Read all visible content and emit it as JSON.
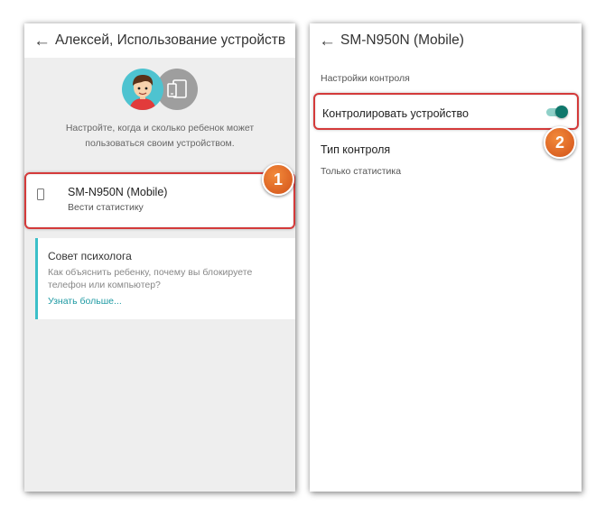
{
  "left_screen": {
    "back_icon": "←",
    "title": "Алексей, Использование устройств",
    "illustration": {
      "avatar_icon": "child-avatar-icon",
      "devices_icon": "devices-icon",
      "colors": {
        "avatar_bg": "#4ec3d0",
        "devices_bg": "#9e9e9e"
      }
    },
    "intro_text": "Настройте, когда и сколько ребенок может пользоваться своим устройством.",
    "device": {
      "icon": "phone-icon",
      "name": "SM-N950N (Mobile)",
      "subtitle": "Вести статистику"
    },
    "tip": {
      "title": "Совет психолога",
      "body": "Как объяснить ребенку, почему вы блокируете телефон или компьютер?",
      "link": "Узнать больше..."
    },
    "callout_number": "1"
  },
  "right_screen": {
    "back_icon": "←",
    "title": "SM-N950N (Mobile)",
    "section_label": "Настройки контроля",
    "control_label": "Контролировать устройство",
    "control_enabled": true,
    "type_label": "Тип контроля",
    "type_value": "Только статистика",
    "callout_number": "2"
  },
  "colors": {
    "accent_teal": "#10786c",
    "link_teal": "#1e9aa3",
    "highlight_red": "#d43a3a",
    "badge_orange": "#e06a28"
  }
}
